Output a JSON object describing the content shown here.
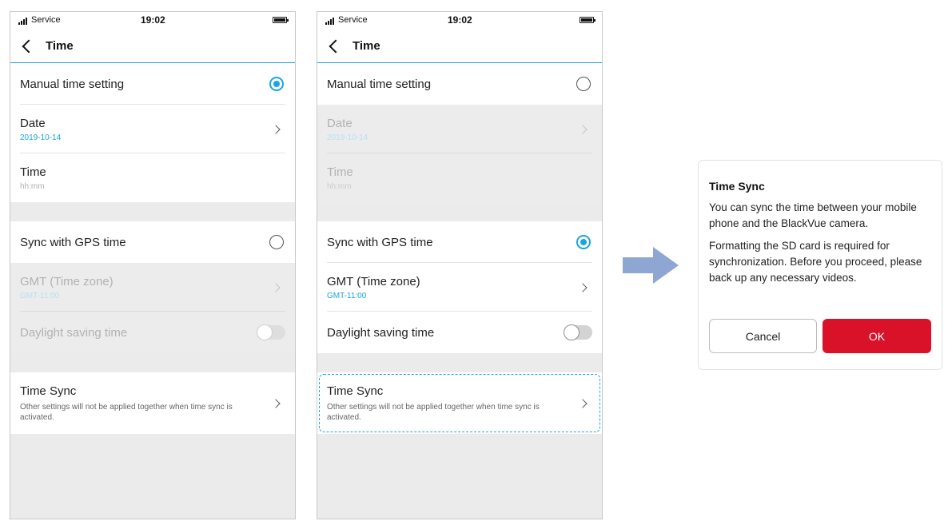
{
  "status_bar": {
    "carrier": "Service",
    "time": "19:02"
  },
  "header": {
    "title": "Time"
  },
  "rows": {
    "manual": "Manual time setting",
    "date_label": "Date",
    "date_value": "2019-10-14",
    "time_label": "Time",
    "time_placeholder": "hh:mm",
    "gps": "Sync with GPS time",
    "gmt_label": "GMT (Time zone)",
    "gmt_value": "GMT-11:00",
    "daylight": "Daylight saving time",
    "timesync_label": "Time Sync",
    "timesync_desc": "Other settings will not be applied together when time sync is activated."
  },
  "screens": [
    {
      "selected_mode": "manual",
      "daylight_saving": false
    },
    {
      "selected_mode": "gps",
      "daylight_saving": false,
      "highlighted_row": "Time Sync"
    }
  ],
  "dialog": {
    "title": "Time Sync",
    "paragraph1": "You can sync the time between your mobile phone and the BlackVue camera.",
    "paragraph2": "Formatting the SD card is required for synchronization. Before you proceed, please back up any necessary videos.",
    "cancel_label": "Cancel",
    "ok_label": "OK"
  },
  "colors": {
    "accent": "#1aa5e0",
    "ok_button": "#d9122a",
    "disabled_bg": "#ececec"
  }
}
